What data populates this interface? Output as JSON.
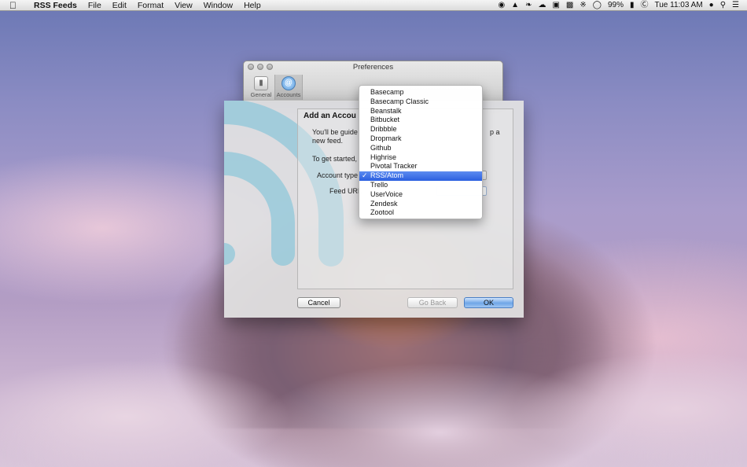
{
  "menubar": {
    "apple_icon": "apple-icon",
    "app_name": "RSS Feeds",
    "menus": [
      "File",
      "Edit",
      "Format",
      "View",
      "Window",
      "Help"
    ],
    "status": {
      "battery": "99%",
      "clock": "Tue 11:03 AM"
    }
  },
  "prefs_window": {
    "title": "Preferences",
    "toolbar": [
      {
        "label": "General",
        "icon": "switch-icon"
      },
      {
        "label": "Accounts",
        "icon": "at-icon"
      }
    ]
  },
  "sheet": {
    "heading": "Add an Accou",
    "description": "You'll be guide",
    "description_right": "p a",
    "description_line2": "new feed.",
    "get_started": "To get started,",
    "account_type_label": "Account type",
    "feed_url_label": "Feed URL",
    "buttons": {
      "cancel": "Cancel",
      "back": "Go Back",
      "ok": "OK"
    }
  },
  "dropdown": {
    "selected": "RSS/Atom",
    "check": "✓",
    "options": [
      "Basecamp",
      "Basecamp Classic",
      "Beanstalk",
      "Bitbucket",
      "Dribbble",
      "Dropmark",
      "Github",
      "Highrise",
      "Pivotal Tracker",
      "RSS/Atom",
      "Trello",
      "UserVoice",
      "Zendesk",
      "Zootool"
    ]
  },
  "colors": {
    "accent": "#3366e0",
    "rss_art": "#8fc7da"
  }
}
